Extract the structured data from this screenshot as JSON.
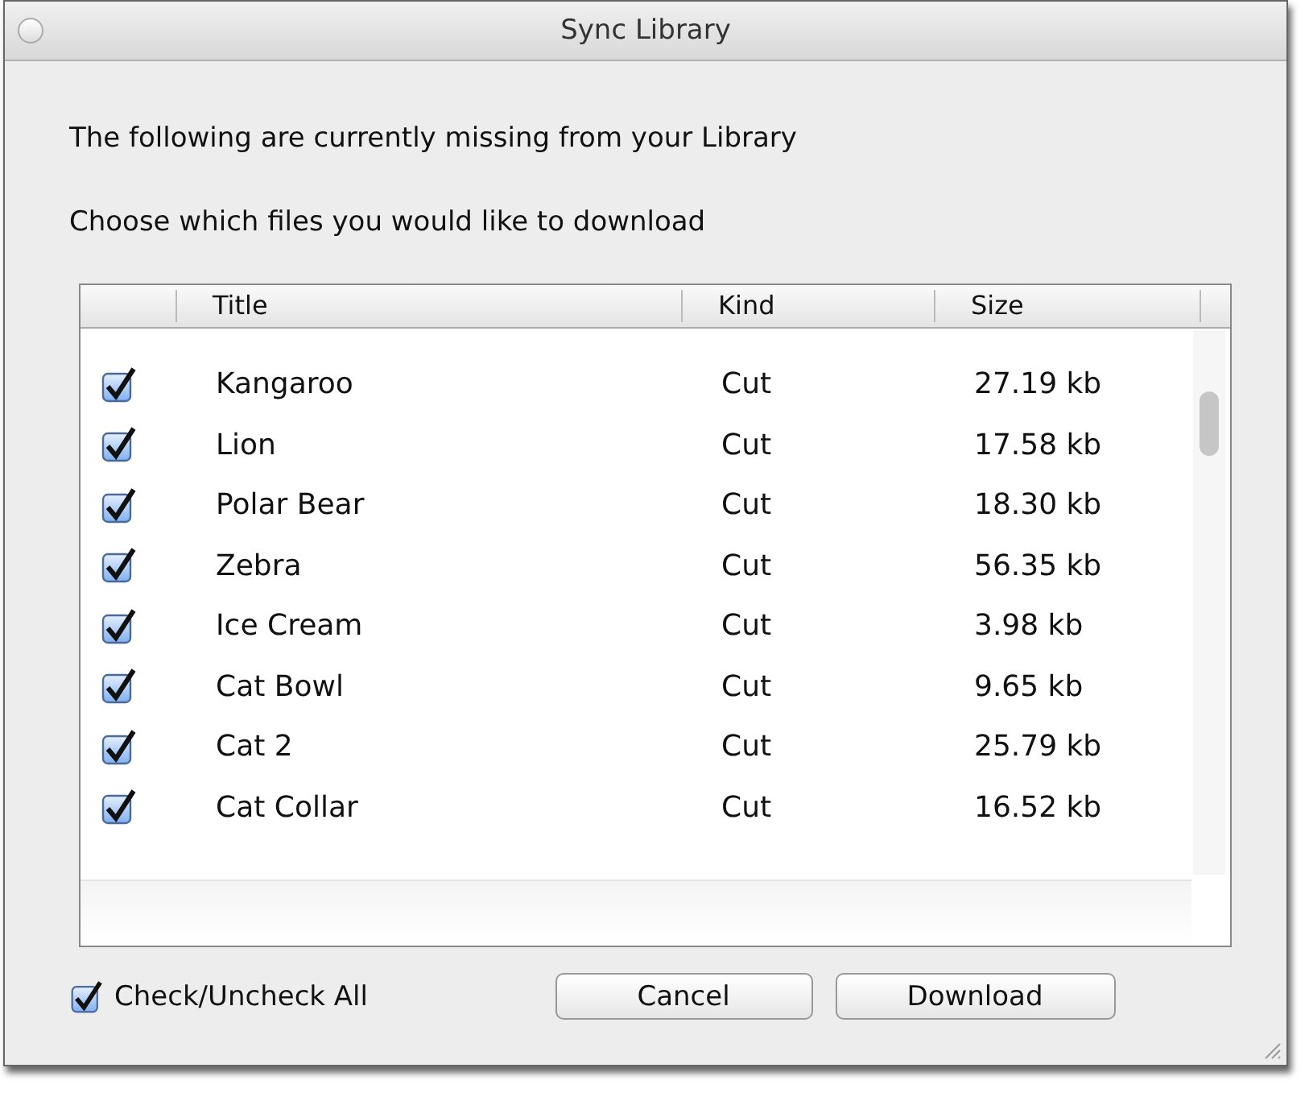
{
  "window": {
    "title": "Sync Library"
  },
  "messages": [
    "The following are currently missing from your Library",
    "Choose which files you would like to download"
  ],
  "table": {
    "columns": [
      "Title",
      "Kind",
      "Size"
    ],
    "rows": [
      {
        "checked": true,
        "title": "Kangaroo",
        "kind": "Cut",
        "size": "27.19 kb"
      },
      {
        "checked": true,
        "title": "Lion",
        "kind": "Cut",
        "size": "17.58 kb"
      },
      {
        "checked": true,
        "title": "Polar Bear",
        "kind": "Cut",
        "size": "18.30 kb"
      },
      {
        "checked": true,
        "title": "Zebra",
        "kind": "Cut",
        "size": "56.35 kb"
      },
      {
        "checked": true,
        "title": "Ice Cream",
        "kind": "Cut",
        "size": "3.98 kb"
      },
      {
        "checked": true,
        "title": "Cat Bowl",
        "kind": "Cut",
        "size": "9.65 kb"
      },
      {
        "checked": true,
        "title": "Cat 2",
        "kind": "Cut",
        "size": "25.79 kb"
      },
      {
        "checked": true,
        "title": "Cat Collar",
        "kind": "Cut",
        "size": "16.52 kb"
      }
    ]
  },
  "check_all": {
    "label": "Check/Uncheck All",
    "checked": true
  },
  "buttons": [
    "Cancel",
    "Download"
  ]
}
